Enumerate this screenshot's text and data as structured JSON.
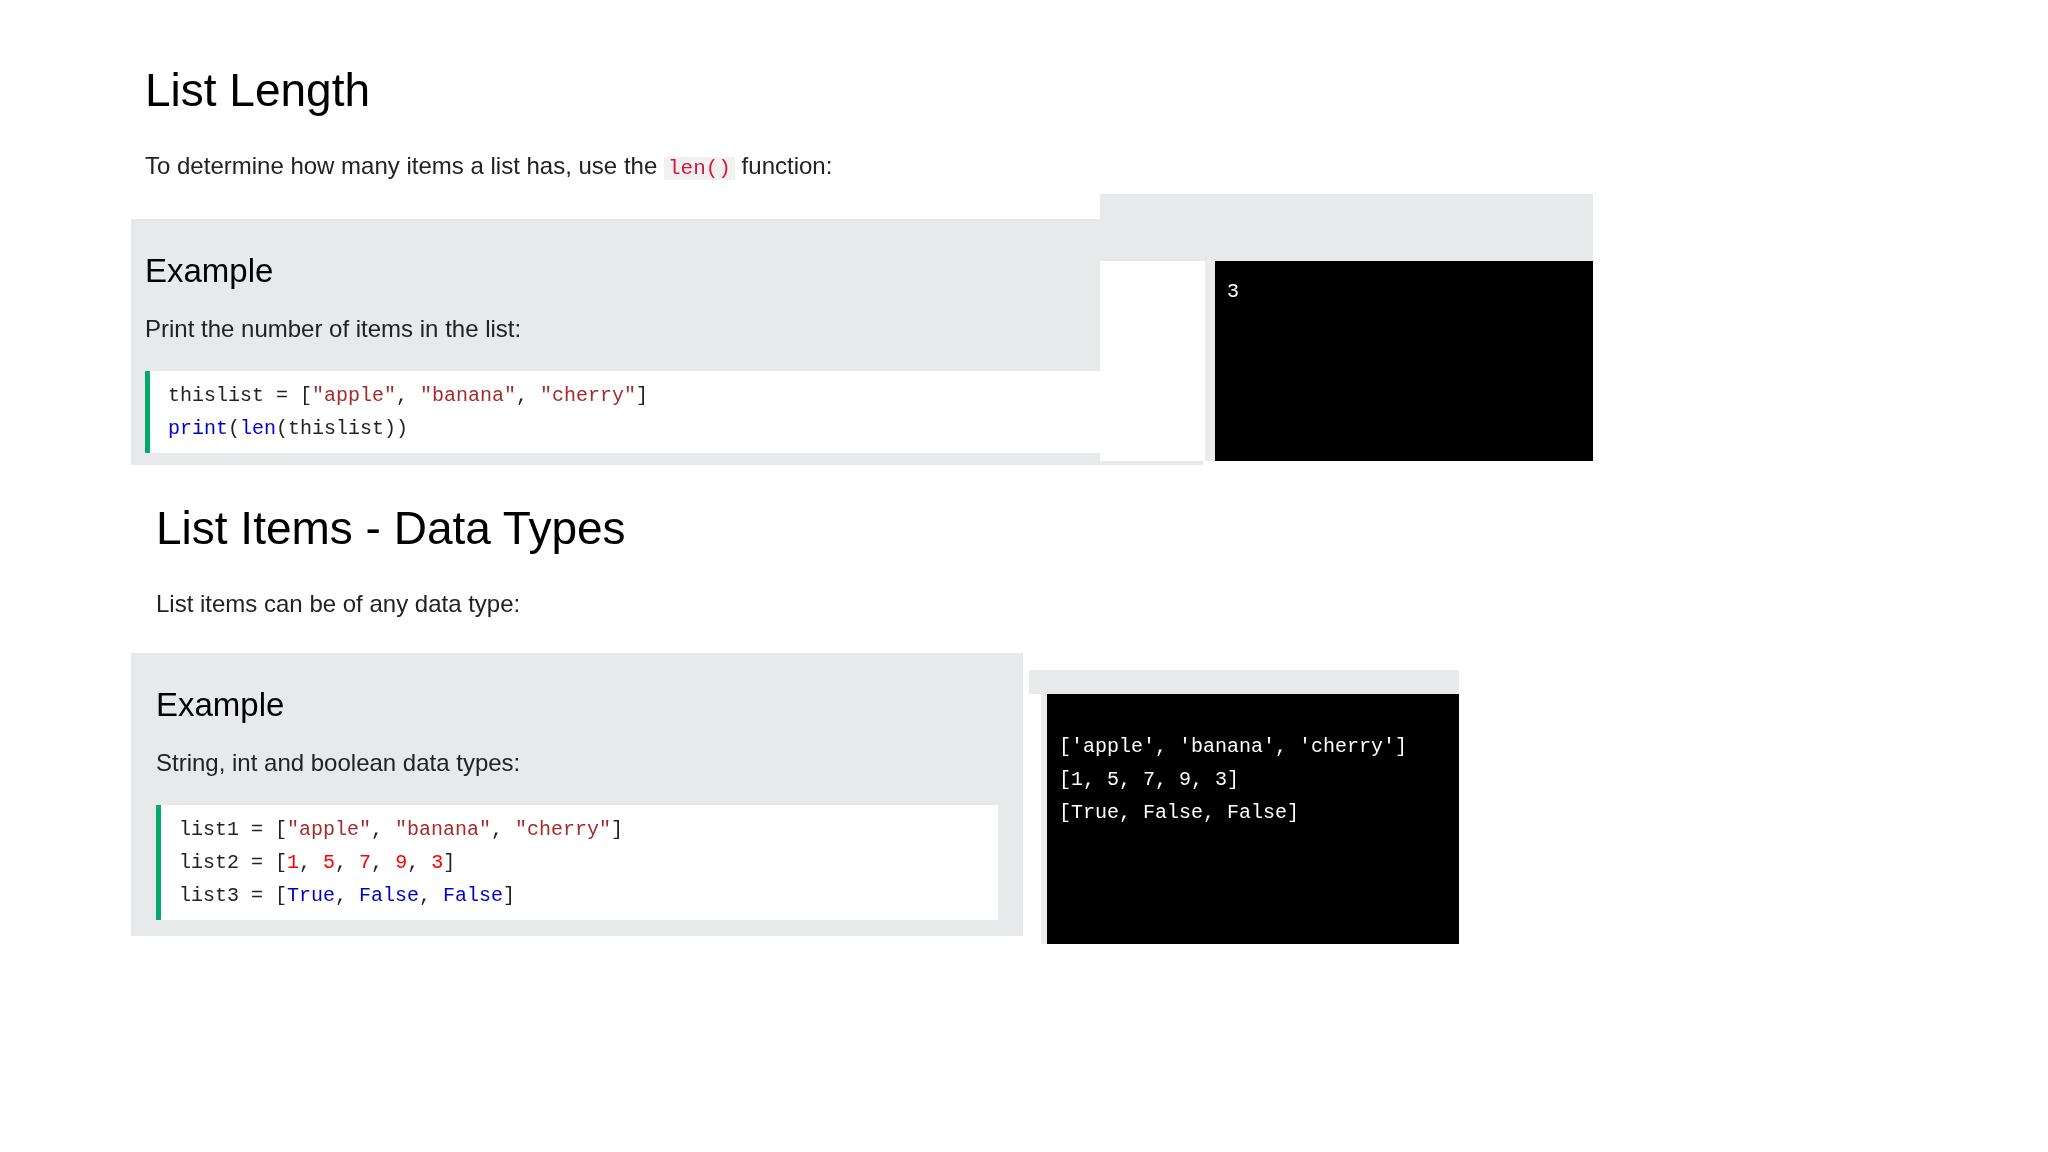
{
  "sections": [
    {
      "title": "List Length",
      "intro": [
        {
          "kind": "text",
          "text": "To determine how many items a list has, use the"
        },
        {
          "kind": "code",
          "text": "len()"
        },
        {
          "kind": "text",
          "text": "function:"
        }
      ],
      "example": {
        "title": "Example",
        "description": "Print the number of items in the list:",
        "code": [
          [
            {
              "kind": "plain",
              "text": "thislist = ["
            },
            {
              "kind": "string",
              "text": "\"apple\""
            },
            {
              "kind": "plain",
              "text": ", "
            },
            {
              "kind": "string",
              "text": "\"banana\""
            },
            {
              "kind": "plain",
              "text": ", "
            },
            {
              "kind": "string",
              "text": "\"cherry\""
            },
            {
              "kind": "plain",
              "text": "]"
            }
          ],
          [
            {
              "kind": "keyword",
              "text": "print"
            },
            {
              "kind": "plain",
              "text": "("
            },
            {
              "kind": "keyword",
              "text": "len"
            },
            {
              "kind": "plain",
              "text": "(thislist))"
            }
          ]
        ]
      },
      "output": [
        "3"
      ]
    },
    {
      "title": "List Items - Data Types",
      "intro": [
        {
          "kind": "text",
          "text": "List items can be of any data type:"
        }
      ],
      "example": {
        "title": "Example",
        "description": "String, int and boolean data types:",
        "code": [
          [
            {
              "kind": "plain",
              "text": "list1 = ["
            },
            {
              "kind": "string",
              "text": "\"apple\""
            },
            {
              "kind": "plain",
              "text": ", "
            },
            {
              "kind": "string",
              "text": "\"banana\""
            },
            {
              "kind": "plain",
              "text": ", "
            },
            {
              "kind": "string",
              "text": "\"cherry\""
            },
            {
              "kind": "plain",
              "text": "]"
            }
          ],
          [
            {
              "kind": "plain",
              "text": "list2 = ["
            },
            {
              "kind": "number",
              "text": "1"
            },
            {
              "kind": "plain",
              "text": ", "
            },
            {
              "kind": "number",
              "text": "5"
            },
            {
              "kind": "plain",
              "text": ", "
            },
            {
              "kind": "number",
              "text": "7"
            },
            {
              "kind": "plain",
              "text": ", "
            },
            {
              "kind": "number",
              "text": "9"
            },
            {
              "kind": "plain",
              "text": ", "
            },
            {
              "kind": "number",
              "text": "3"
            },
            {
              "kind": "plain",
              "text": "]"
            }
          ],
          [
            {
              "kind": "plain",
              "text": "list3 = ["
            },
            {
              "kind": "keyword",
              "text": "True"
            },
            {
              "kind": "plain",
              "text": ", "
            },
            {
              "kind": "keyword",
              "text": "False"
            },
            {
              "kind": "plain",
              "text": ", "
            },
            {
              "kind": "keyword",
              "text": "False"
            },
            {
              "kind": "plain",
              "text": "]"
            }
          ]
        ]
      },
      "output": [
        "['apple', 'banana', 'cherry']",
        "[1, 5, 7, 9, 3]",
        "[True, False, False]"
      ]
    }
  ]
}
